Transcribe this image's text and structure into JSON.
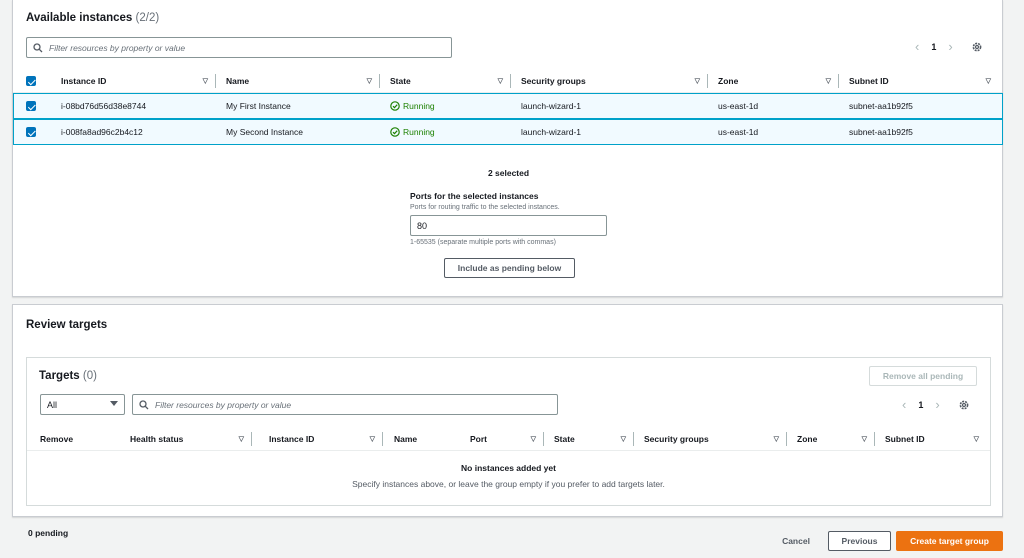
{
  "available": {
    "title": "Available instances",
    "count": "(2/2)",
    "search_placeholder": "Filter resources by property or value",
    "page": "1",
    "columns": [
      "Instance ID",
      "Name",
      "State",
      "Security groups",
      "Zone",
      "Subnet ID"
    ],
    "rows": [
      {
        "instance_id": "i-08bd76d56d38e8744",
        "name": "My First Instance",
        "state": "Running",
        "security_group": "launch-wizard-1",
        "zone": "us-east-1d",
        "subnet": "subnet-aa1b92f5"
      },
      {
        "instance_id": "i-008fa8ad96c2b4c12",
        "name": "My Second Instance",
        "state": "Running",
        "security_group": "launch-wizard-1",
        "zone": "us-east-1d",
        "subnet": "subnet-aa1b92f5"
      }
    ],
    "selected_text": "2 selected",
    "ports_label": "Ports for the selected instances",
    "ports_desc": "Ports for routing traffic to the selected instances.",
    "ports_value": "80",
    "ports_hint": "1-65535 (separate multiple ports with commas)",
    "include_button": "Include as pending below"
  },
  "review": {
    "title": "Review targets",
    "targets_title": "Targets",
    "targets_count": "(0)",
    "remove_all_button": "Remove all pending",
    "filter_value": "All",
    "search_placeholder": "Filter resources by property or value",
    "page": "1",
    "columns": [
      "Remove",
      "Health status",
      "Instance ID",
      "Name",
      "Port",
      "State",
      "Security groups",
      "Zone",
      "Subnet ID"
    ],
    "empty_title": "No instances added yet",
    "empty_desc": "Specify instances above, or leave the group empty if you prefer to add targets later."
  },
  "footer": {
    "pending": "0 pending",
    "cancel": "Cancel",
    "previous": "Previous",
    "create": "Create target group"
  },
  "colors": {
    "primary": "#ec7211",
    "selected_row_bg": "#f1faff",
    "selected_row_border": "#00a1c9",
    "running": "#1d8102",
    "checkbox": "#0073bb"
  }
}
